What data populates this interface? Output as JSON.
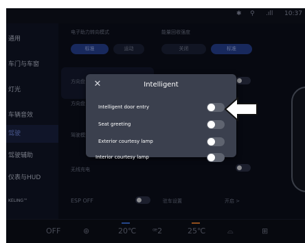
{
  "status": {
    "time": "10:37",
    "signal": ".ıll",
    "bluetooth": "✱",
    "location": "⚲"
  },
  "sidebar": {
    "items": [
      {
        "label": "通用",
        "active": false
      },
      {
        "label": "车门与车窗",
        "active": false
      },
      {
        "label": "灯光",
        "active": false
      },
      {
        "label": "车辆音效",
        "active": false
      },
      {
        "label": "驾驶",
        "active": true
      },
      {
        "label": "驾驶辅助",
        "active": false
      },
      {
        "label": "仪表与HUD",
        "active": false
      },
      {
        "label": "KELING™",
        "active": false
      }
    ]
  },
  "background": {
    "label_top_left": "电子助力转向模式",
    "label_top_right": "能量回收强度",
    "pill_a": "标准",
    "pill_b": "运动",
    "pill_c": "关闭",
    "pill_d": "标准",
    "left_labels": [
      "方向盘",
      "方向盘",
      "驾驶模式",
      "无线充电"
    ],
    "esp_label": "ESP OFF",
    "parking_label": "驻车设置",
    "parking_value": "开启 >"
  },
  "dialog": {
    "title": "Intelligent",
    "rows": [
      {
        "label": "Intelligent door entry",
        "on": false
      },
      {
        "label": "Seat greeting",
        "on": false
      },
      {
        "label": "Exterior courtesy lamp",
        "on": false
      },
      {
        "label": "Interior courtesy lamp",
        "on": false
      }
    ]
  },
  "bottombar": {
    "ac": "OFF",
    "fan": "⊛",
    "temp_left": "20℃",
    "seat_icon": "ꟹ2",
    "temp_right": "25℃",
    "defrost_front": "⌓",
    "defrost_rear": "⊞"
  },
  "colors": {
    "accent": "#6d84d8",
    "temp_left_line": "#3b6fd6",
    "temp_right_line": "#e07a2f"
  }
}
